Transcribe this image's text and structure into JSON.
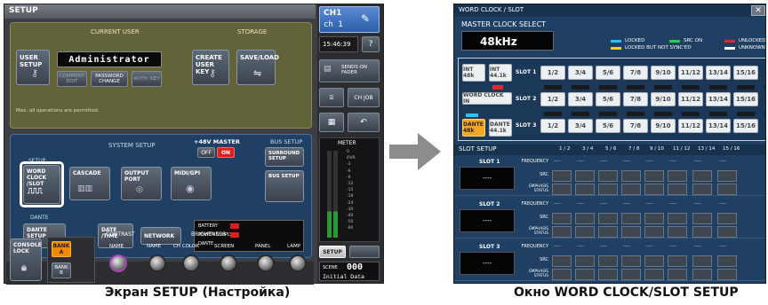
{
  "left": {
    "title": "SETUP",
    "current_user": {
      "section_title": "CURRENT USER",
      "user_setup": "USER SETUP",
      "user_name": "Administrator",
      "comment_edit": "COMMENT EDIT",
      "password_change": "PASSWORD CHANGE",
      "auth_key": "AUTH. KEY",
      "status": "Max. all operations are permitted."
    },
    "storage": {
      "section_title": "STORAGE",
      "create_user_key": "CREATE USER KEY",
      "save_load": "SAVE/LOAD"
    },
    "system_setup": {
      "section_title": "SYSTEM SETUP",
      "master48": "+48V MASTER",
      "off": "OFF",
      "on": "ON",
      "setup_label": "SETUP",
      "word_clock": "WORD CLOCK /SLOT",
      "cascade": "CASCADE",
      "output_port": "OUTPUT PORT",
      "midi_gpi": "MIDI/GPI"
    },
    "bus_setup": {
      "section_title": "BUS SETUP",
      "surround": "SURROUND SETUP",
      "bus_setup": "BUS SETUP"
    },
    "dante": {
      "section_title": "DANTE",
      "dante_setup": "DANTE SETUP",
      "date_time": "DATE /TIME",
      "network": "NETWORK",
      "battery": "BATTERY",
      "power_supply": "POWER SUPPLY",
      "dante_status": "DANTE"
    },
    "contrast": {
      "section_title": "CONTRAST",
      "name": "NAME"
    },
    "brightness": {
      "section_title": "BRIGHTNESS",
      "knobs": [
        "NAME",
        "CH COLOR",
        "SCREEN",
        "PANEL",
        "LAMP"
      ]
    },
    "console_lock": "CONSOLE LOCK",
    "bank_a": "BANK A",
    "bank_b": "BANK B",
    "side": {
      "channel_label": "CH1",
      "channel_name": "ch 1",
      "time": "15:46:39",
      "sends_on_fader": "SENDS ON FADER",
      "ch_job": "CH JOB",
      "meter": "METER",
      "meter_scale": [
        "0",
        "OVR",
        "-3",
        "-6",
        "-9",
        "-12",
        "-15",
        "-18",
        "-24",
        "-30",
        "-40",
        "-50",
        "-60"
      ],
      "setup": "SETUP",
      "scene_label": "SCENE",
      "scene_number": "000",
      "scene_name": "Initial Data"
    },
    "caption": "Экран SETUP (Настройка)"
  },
  "right": {
    "title": "WORD CLOCK / SLOT",
    "master_clock_select": "MASTER CLOCK SELECT",
    "master_clock_value": "48kHz",
    "legend": {
      "locked": "LOCKED",
      "src_on": "SRC ON",
      "unlocked": "UNLOCKED",
      "locked_not_synced": "LOCKED BUT NOT SYNC'ED",
      "unknown": "UNKNOWN"
    },
    "clock_sources": {
      "int48": "INT 48k",
      "int441": "INT 44.1k",
      "word_clock_in": "WORD CLOCK IN",
      "dante48": "DANTE 48k",
      "dante441": "DANTE 44.1k"
    },
    "slots": [
      "SLOT 1",
      "SLOT 2",
      "SLOT 3"
    ],
    "channel_pairs": [
      "1/2",
      "3/4",
      "5/6",
      "7/8",
      "9/10",
      "11/12",
      "13/14",
      "15/16"
    ],
    "slot_setup": {
      "title": "SLOT SETUP",
      "columns": [
        "1 / 2",
        "3 / 4",
        "5 / 6",
        "7 / 8",
        "9 / 10",
        "11 / 12",
        "13 / 14",
        "15 / 16"
      ],
      "rows": [
        "FREQUENCY",
        "SRC",
        "EMPHASIS STATUS"
      ],
      "slot_names": [
        "SLOT 1",
        "SLOT 2",
        "SLOT 3"
      ],
      "empty_value": "----"
    },
    "caption": "Окно WORD CLOCK/SLOT SETUP"
  },
  "colors": {
    "locked": "#27c4f0",
    "src_on": "#2ecc40",
    "unlocked": "#e8262b",
    "locked_not_synced": "#f2d21a",
    "unknown": "#ffffff",
    "panel_blue": "#1f3f63",
    "storage_olive": "#6b6a3a",
    "active_orange": "#f08a00",
    "arrow": "#8c8c8c"
  }
}
